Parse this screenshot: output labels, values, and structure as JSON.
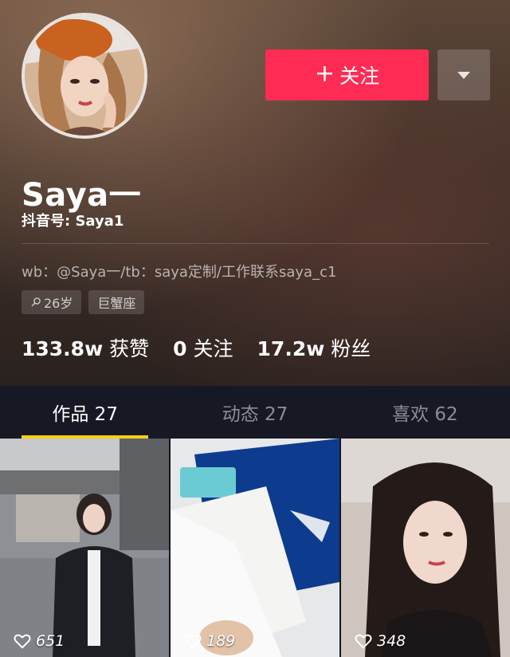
{
  "profile": {
    "name": "Saya一",
    "douyin_id": "抖音号: Saya1",
    "bio": "wb：@Saya一/tb：saya定制/工作联系saya_c1",
    "tags": [
      {
        "icon": "female-icon",
        "label": "26岁"
      },
      {
        "icon": "",
        "label": "巨蟹座"
      }
    ]
  },
  "actions": {
    "follow_label": "关注",
    "follow_plus": "+",
    "more_icon": "chevron-down-icon"
  },
  "stats": [
    {
      "value": "133.8w",
      "label": "获赞"
    },
    {
      "value": "0",
      "label": "关注"
    },
    {
      "value": "17.2w",
      "label": "粉丝"
    }
  ],
  "tabs": [
    {
      "label": "作品 27",
      "active": true
    },
    {
      "label": "动态 27",
      "active": false
    },
    {
      "label": "喜欢 62",
      "active": false
    }
  ],
  "videos": [
    {
      "likes": "651",
      "icon": "heart-icon"
    },
    {
      "likes": "189",
      "icon": "heart-icon"
    },
    {
      "likes": "348",
      "icon": "heart-icon"
    }
  ],
  "colors": {
    "accent": "#fe2c55",
    "tab_indicator": "#face15",
    "background": "#161823"
  }
}
